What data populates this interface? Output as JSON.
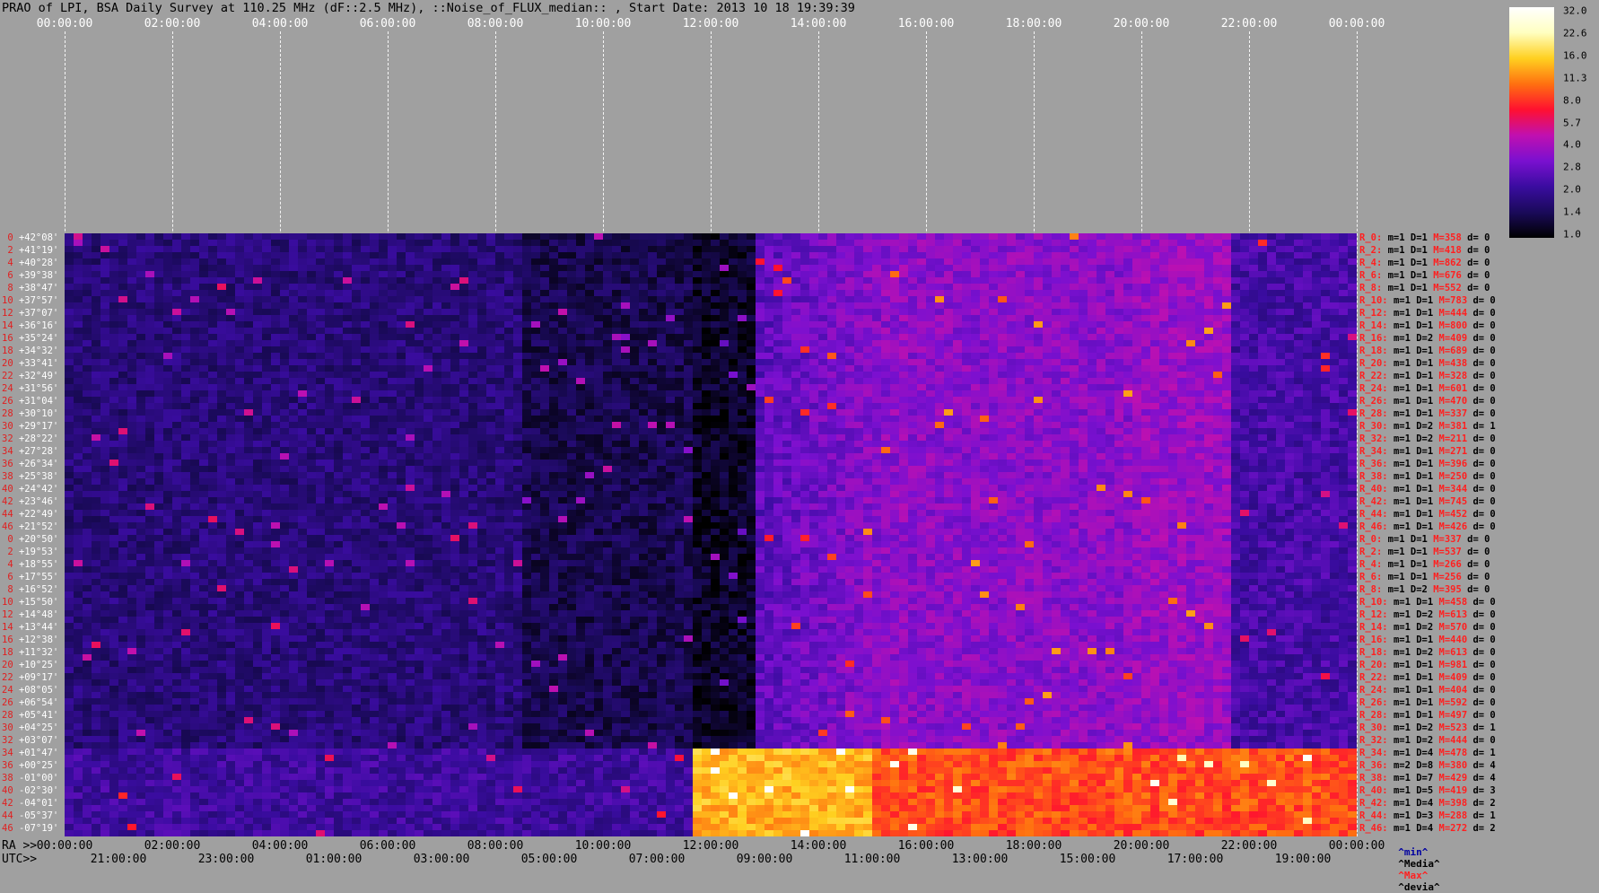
{
  "title": "PRAO of LPI, BSA Daily Survey at 110.25 MHz (dF::2.5 MHz), ::Noise_of_FLUX_median:: , Start Date: 2013 10 18 19:39:39",
  "chart_data": {
    "type": "heatmap",
    "title": "PRAO of LPI, BSA Daily Survey at 110.25 MHz (dF::2.5 MHz), ::Noise_of_FLUX_median:: , Start Date: 2013 10 18 19:39:39",
    "top_axis_ticks": [
      "00:00:00",
      "02:00:00",
      "04:00:00",
      "06:00:00",
      "08:00:00",
      "10:00:00",
      "12:00:00",
      "14:00:00",
      "16:00:00",
      "18:00:00",
      "20:00:00",
      "22:00:00",
      "00:00:00"
    ],
    "bottom_ra_prefix": "RA >>",
    "bottom_ra_ticks": [
      "00:00:00",
      "02:00:00",
      "04:00:00",
      "06:00:00",
      "08:00:00",
      "10:00:00",
      "12:00:00",
      "14:00:00",
      "16:00:00",
      "18:00:00",
      "20:00:00",
      "22:00:00",
      "00:00:00"
    ],
    "bottom_utc_prefix": "UTC>>",
    "bottom_utc_ticks": [
      "21:00:00",
      "23:00:00",
      "01:00:00",
      "03:00:00",
      "05:00:00",
      "07:00:00",
      "09:00:00",
      "11:00:00",
      "13:00:00",
      "15:00:00",
      "17:00:00",
      "19:00:00"
    ],
    "colorbar_ticks": [
      "32.0",
      "22.6",
      "16.0",
      "11.3",
      "8.0",
      "5.7",
      "4.0",
      "2.8",
      "2.0",
      "1.4",
      "1.0"
    ],
    "colormap": [
      "#000000",
      "#1a0a5a",
      "#3a0ca0",
      "#7a10d0",
      "#c010b0",
      "#ff1030",
      "#ff7010",
      "#ffd020",
      "#ffffc0",
      "#ffffff"
    ],
    "row_labels": [
      {
        "idx": "0",
        "dec": "+42°08'"
      },
      {
        "idx": "2",
        "dec": "+41°19'"
      },
      {
        "idx": "4",
        "dec": "+40°28'"
      },
      {
        "idx": "6",
        "dec": "+39°38'"
      },
      {
        "idx": "8",
        "dec": "+38°47'"
      },
      {
        "idx": "10",
        "dec": "+37°57'"
      },
      {
        "idx": "12",
        "dec": "+37°07'"
      },
      {
        "idx": "14",
        "dec": "+36°16'"
      },
      {
        "idx": "16",
        "dec": "+35°24'"
      },
      {
        "idx": "18",
        "dec": "+34°32'"
      },
      {
        "idx": "20",
        "dec": "+33°41'"
      },
      {
        "idx": "22",
        "dec": "+32°49'"
      },
      {
        "idx": "24",
        "dec": "+31°56'"
      },
      {
        "idx": "26",
        "dec": "+31°04'"
      },
      {
        "idx": "28",
        "dec": "+30°10'"
      },
      {
        "idx": "30",
        "dec": "+29°17'"
      },
      {
        "idx": "32",
        "dec": "+28°22'"
      },
      {
        "idx": "34",
        "dec": "+27°28'"
      },
      {
        "idx": "36",
        "dec": "+26°34'"
      },
      {
        "idx": "38",
        "dec": "+25°38'"
      },
      {
        "idx": "40",
        "dec": "+24°42'"
      },
      {
        "idx": "42",
        "dec": "+23°46'"
      },
      {
        "idx": "44",
        "dec": "+22°49'"
      },
      {
        "idx": "46",
        "dec": "+21°52'"
      },
      {
        "idx": "0",
        "dec": "+20°50'"
      },
      {
        "idx": "2",
        "dec": "+19°53'"
      },
      {
        "idx": "4",
        "dec": "+18°55'"
      },
      {
        "idx": "6",
        "dec": "+17°55'"
      },
      {
        "idx": "8",
        "dec": "+16°52'"
      },
      {
        "idx": "10",
        "dec": "+15°50'"
      },
      {
        "idx": "12",
        "dec": "+14°48'"
      },
      {
        "idx": "14",
        "dec": "+13°44'"
      },
      {
        "idx": "16",
        "dec": "+12°38'"
      },
      {
        "idx": "18",
        "dec": "+11°32'"
      },
      {
        "idx": "20",
        "dec": "+10°25'"
      },
      {
        "idx": "22",
        "dec": "+09°17'"
      },
      {
        "idx": "24",
        "dec": "+08°05'"
      },
      {
        "idx": "26",
        "dec": "+06°54'"
      },
      {
        "idx": "28",
        "dec": "+05°41'"
      },
      {
        "idx": "30",
        "dec": "+04°25'"
      },
      {
        "idx": "32",
        "dec": "+03°07'"
      },
      {
        "idx": "34",
        "dec": "+01°47'"
      },
      {
        "idx": "36",
        "dec": "+00°25'"
      },
      {
        "idx": "38",
        "dec": "-01°00'"
      },
      {
        "idx": "40",
        "dec": "-02°30'"
      },
      {
        "idx": "42",
        "dec": "-04°01'"
      },
      {
        "idx": "44",
        "dec": "-05°37'"
      },
      {
        "idx": "46",
        "dec": "-07°19'"
      }
    ],
    "right_rows": [
      {
        "r": "R_0:",
        "m": "m=1",
        "D": "D=1",
        "M": "M=358",
        "d": "d= 0"
      },
      {
        "r": "R_2:",
        "m": "m=1",
        "D": "D=1",
        "M": "M=418",
        "d": "d= 0"
      },
      {
        "r": "R_4:",
        "m": "m=1",
        "D": "D=1",
        "M": "M=862",
        "d": "d= 0"
      },
      {
        "r": "R_6:",
        "m": "m=1",
        "D": "D=1",
        "M": "M=676",
        "d": "d= 0"
      },
      {
        "r": "R_8:",
        "m": "m=1",
        "D": "D=1",
        "M": "M=552",
        "d": "d= 0"
      },
      {
        "r": "R_10:",
        "m": "m=1",
        "D": "D=1",
        "M": "M=783",
        "d": "d= 0"
      },
      {
        "r": "R_12:",
        "m": "m=1",
        "D": "D=1",
        "M": "M=444",
        "d": "d= 0"
      },
      {
        "r": "R_14:",
        "m": "m=1",
        "D": "D=1",
        "M": "M=800",
        "d": "d= 0"
      },
      {
        "r": "R_16:",
        "m": "m=1",
        "D": "D=2",
        "M": "M=409",
        "d": "d= 0"
      },
      {
        "r": "R_18:",
        "m": "m=1",
        "D": "D=1",
        "M": "M=689",
        "d": "d= 0"
      },
      {
        "r": "R_20:",
        "m": "m=1",
        "D": "D=1",
        "M": "M=438",
        "d": "d= 0"
      },
      {
        "r": "R_22:",
        "m": "m=1",
        "D": "D=1",
        "M": "M=328",
        "d": "d= 0"
      },
      {
        "r": "R_24:",
        "m": "m=1",
        "D": "D=1",
        "M": "M=601",
        "d": "d= 0"
      },
      {
        "r": "R_26:",
        "m": "m=1",
        "D": "D=1",
        "M": "M=470",
        "d": "d= 0"
      },
      {
        "r": "R_28:",
        "m": "m=1",
        "D": "D=1",
        "M": "M=337",
        "d": "d= 0"
      },
      {
        "r": "R_30:",
        "m": "m=1",
        "D": "D=2",
        "M": "M=381",
        "d": "d= 1"
      },
      {
        "r": "R_32:",
        "m": "m=1",
        "D": "D=2",
        "M": "M=211",
        "d": "d= 0"
      },
      {
        "r": "R_34:",
        "m": "m=1",
        "D": "D=1",
        "M": "M=271",
        "d": "d= 0"
      },
      {
        "r": "R_36:",
        "m": "m=1",
        "D": "D=1",
        "M": "M=396",
        "d": "d= 0"
      },
      {
        "r": "R_38:",
        "m": "m=1",
        "D": "D=1",
        "M": "M=250",
        "d": "d= 0"
      },
      {
        "r": "R_40:",
        "m": "m=1",
        "D": "D=1",
        "M": "M=344",
        "d": "d= 0"
      },
      {
        "r": "R_42:",
        "m": "m=1",
        "D": "D=1",
        "M": "M=745",
        "d": "d= 0"
      },
      {
        "r": "R_44:",
        "m": "m=1",
        "D": "D=1",
        "M": "M=452",
        "d": "d= 0"
      },
      {
        "r": "R_46:",
        "m": "m=1",
        "D": "D=1",
        "M": "M=426",
        "d": "d= 0"
      },
      {
        "r": "R_0:",
        "m": "m=1",
        "D": "D=1",
        "M": "M=337",
        "d": "d= 0"
      },
      {
        "r": "R_2:",
        "m": "m=1",
        "D": "D=1",
        "M": "M=537",
        "d": "d= 0"
      },
      {
        "r": "R_4:",
        "m": "m=1",
        "D": "D=1",
        "M": "M=266",
        "d": "d= 0"
      },
      {
        "r": "R_6:",
        "m": "m=1",
        "D": "D=1",
        "M": "M=256",
        "d": "d= 0"
      },
      {
        "r": "R_8:",
        "m": "m=1",
        "D": "D=2",
        "M": "M=395",
        "d": "d= 0"
      },
      {
        "r": "R_10:",
        "m": "m=1",
        "D": "D=1",
        "M": "M=458",
        "d": "d= 0"
      },
      {
        "r": "R_12:",
        "m": "m=1",
        "D": "D=2",
        "M": "M=613",
        "d": "d= 0"
      },
      {
        "r": "R_14:",
        "m": "m=1",
        "D": "D=2",
        "M": "M=570",
        "d": "d= 0"
      },
      {
        "r": "R_16:",
        "m": "m=1",
        "D": "D=1",
        "M": "M=440",
        "d": "d= 0"
      },
      {
        "r": "R_18:",
        "m": "m=1",
        "D": "D=2",
        "M": "M=613",
        "d": "d= 0"
      },
      {
        "r": "R_20:",
        "m": "m=1",
        "D": "D=1",
        "M": "M=981",
        "d": "d= 0"
      },
      {
        "r": "R_22:",
        "m": "m=1",
        "D": "D=1",
        "M": "M=409",
        "d": "d= 0"
      },
      {
        "r": "R_24:",
        "m": "m=1",
        "D": "D=1",
        "M": "M=404",
        "d": "d= 0"
      },
      {
        "r": "R_26:",
        "m": "m=1",
        "D": "D=1",
        "M": "M=592",
        "d": "d= 0"
      },
      {
        "r": "R_28:",
        "m": "m=1",
        "D": "D=1",
        "M": "M=497",
        "d": "d= 0"
      },
      {
        "r": "R_30:",
        "m": "m=1",
        "D": "D=2",
        "M": "M=523",
        "d": "d= 1"
      },
      {
        "r": "R_32:",
        "m": "m=1",
        "D": "D=2",
        "M": "M=444",
        "d": "d= 0"
      },
      {
        "r": "R_34:",
        "m": "m=1",
        "D": "D=4",
        "M": "M=478",
        "d": "d= 1"
      },
      {
        "r": "R_36:",
        "m": "m=2",
        "D": "D=8",
        "M": "M=380",
        "d": "d= 4"
      },
      {
        "r": "R_38:",
        "m": "m=1",
        "D": "D=7",
        "M": "M=429",
        "d": "d= 4"
      },
      {
        "r": "R_40:",
        "m": "m=1",
        "D": "D=5",
        "M": "M=419",
        "d": "d= 3"
      },
      {
        "r": "R_42:",
        "m": "m=1",
        "D": "D=4",
        "M": "M=398",
        "d": "d= 2"
      },
      {
        "r": "R_44:",
        "m": "m=1",
        "D": "D=3",
        "M": "M=288",
        "d": "d= 1"
      },
      {
        "r": "R_46:",
        "m": "m=1",
        "D": "D=4",
        "M": "M=272",
        "d": "d= 2"
      }
    ],
    "stats_legend": {
      "min": "^min^",
      "median": "^Media^",
      "max": "^Max^",
      "dev": "^devia^"
    },
    "grid": true
  }
}
